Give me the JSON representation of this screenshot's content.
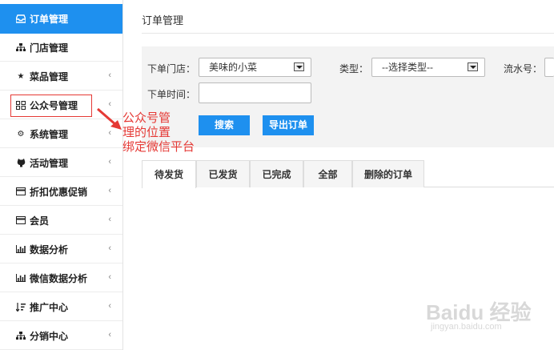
{
  "sidebar": {
    "items": [
      {
        "label": "订单管理",
        "icon": "inbox-icon",
        "chevron": false,
        "active": true
      },
      {
        "label": "门店管理",
        "icon": "sitemap-icon",
        "chevron": false
      },
      {
        "label": "菜品管理",
        "icon": "star-icon",
        "chevron": true
      },
      {
        "label": "公众号管理",
        "icon": "grid-icon",
        "chevron": true
      },
      {
        "label": "系统管理",
        "icon": "gear-icon",
        "chevron": true
      },
      {
        "label": "活动管理",
        "icon": "github-icon",
        "chevron": true
      },
      {
        "label": "折扣优惠促销",
        "icon": "credit-card-icon",
        "chevron": true
      },
      {
        "label": "会员",
        "icon": "credit-card-icon",
        "chevron": true
      },
      {
        "label": "数据分析",
        "icon": "bar-chart-icon",
        "chevron": true
      },
      {
        "label": "微信数据分析",
        "icon": "bar-chart-icon",
        "chevron": true
      },
      {
        "label": "推广中心",
        "icon": "sort-icon",
        "chevron": true
      },
      {
        "label": "分销中心",
        "icon": "sitemap-icon",
        "chevron": true
      }
    ],
    "chevron_glyph": "‹",
    "active_color": "#1e90ef"
  },
  "main": {
    "title": "订单管理",
    "filter": {
      "store_label": "下单门店：",
      "store_value": "美味的小菜",
      "type_label": "类型：",
      "type_value": "--选择类型--",
      "serial_label": "流水号：",
      "time_label": "下单时间：",
      "search_button": "搜索",
      "export_button": "导出订单"
    },
    "tabs": [
      "待发货",
      "已发货",
      "已完成",
      "全部",
      "删除的订单"
    ]
  },
  "annotation": {
    "lines": [
      "公众号管",
      "理的位置",
      "绑定微信平台"
    ],
    "color": "#e53935"
  },
  "watermark": {
    "brand": "Baidu 经验",
    "url": "jingyan.baidu.com"
  }
}
